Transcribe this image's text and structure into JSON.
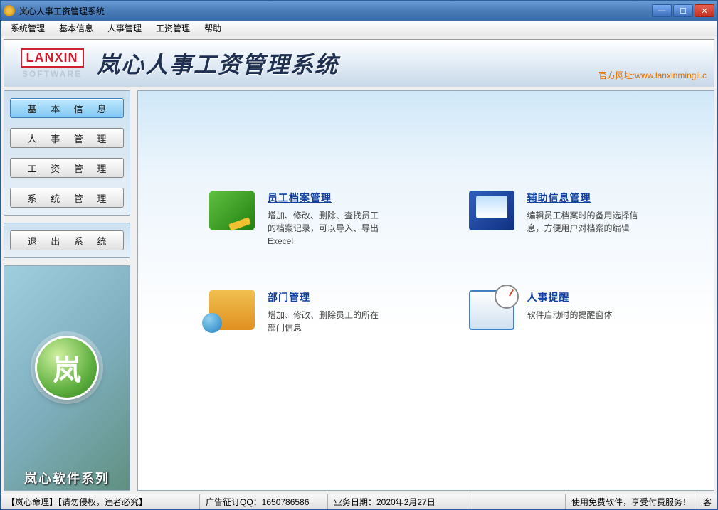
{
  "window": {
    "title": "岚心人事工资管理系统"
  },
  "menu": {
    "items": [
      "系统管理",
      "基本信息",
      "人事管理",
      "工资管理",
      "帮助"
    ]
  },
  "banner": {
    "logo_main": "LANXIN",
    "logo_sub": "SOFTWARE",
    "title": "岚心人事工资管理系统",
    "link_label": "官方网址:",
    "link_url": "www.lanxinmingli.c"
  },
  "sidebar": {
    "buttons": [
      {
        "label": "基 本 信 息",
        "active": true
      },
      {
        "label": "人 事 管 理",
        "active": false
      },
      {
        "label": "工 资 管 理",
        "active": false
      },
      {
        "label": "系 统 管 理",
        "active": false
      }
    ],
    "exit_label": "退 出 系 统",
    "footer_text": "岚心软件系列",
    "orb_char": "岚"
  },
  "features": [
    {
      "title": "员工档案管理",
      "desc": "增加、修改、删除、查找员工的档案记录，可以导入、导出Execel",
      "icon": "archive-icon"
    },
    {
      "title": "辅助信息管理",
      "desc": "编辑员工档案时的备用选择信息，方便用户对档案的编辑",
      "icon": "monitor-icon"
    },
    {
      "title": "部门管理",
      "desc": "增加、修改、删除员工的所在部门信息",
      "icon": "folder-icon"
    },
    {
      "title": "人事提醒",
      "desc": "软件启动时的提醒窗体",
      "icon": "calendar-icon"
    }
  ],
  "status": {
    "left": "【岚心命理】【请勿侵权，违者必究】",
    "ad": "广告征订QQ：1650786586",
    "date": "业务日期：2020年2月27日",
    "right": "使用免费软件，享受付费服务！",
    "tail": "客"
  }
}
